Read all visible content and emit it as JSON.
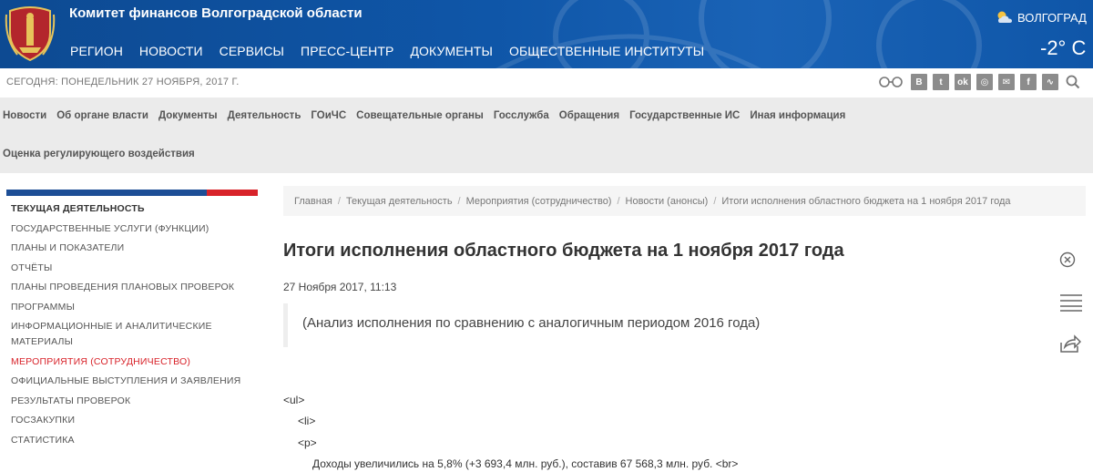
{
  "header": {
    "site_title": "Комитет финансов Волгоградской области",
    "nav": [
      "РЕГИОН",
      "НОВОСТИ",
      "СЕРВИСЫ",
      "ПРЕСС-ЦЕНТР",
      "ДОКУМЕНТЫ",
      "ОБЩЕСТВЕННЫЕ ИНСТИТУТЫ"
    ],
    "weather": {
      "city": "ВОЛГОГРАД",
      "temp": "-2° C",
      "icon": "partly-cloudy-icon"
    },
    "emblem_icon": "coat-of-arms-icon"
  },
  "date_bar": {
    "text": "СЕГОДНЯ: ПОНЕДЕЛЬНИК 27 НОЯБРЯ, 2017 Г.",
    "social": [
      {
        "name": "vk-icon",
        "glyph": "В"
      },
      {
        "name": "twitter-icon",
        "glyph": "t"
      },
      {
        "name": "odnoklassniki-icon",
        "glyph": "ok"
      },
      {
        "name": "instagram-icon",
        "glyph": "◎"
      },
      {
        "name": "mail-icon",
        "glyph": "✉"
      },
      {
        "name": "facebook-icon",
        "glyph": "f"
      },
      {
        "name": "rss-icon",
        "glyph": "∿"
      }
    ]
  },
  "secondary_nav": {
    "row1": [
      "Новости",
      "Об органе власти",
      "Документы",
      "Деятельность",
      "ГОиЧС",
      "Совещательные органы",
      "Госслужба",
      "Обращения",
      "Государственные ИС",
      "Иная информация"
    ],
    "row2": [
      "Оценка регулирующего воздействия"
    ]
  },
  "sidebar": {
    "items": [
      {
        "label": "ТЕКУЩАЯ ДЕЯТЕЛЬНОСТЬ",
        "type": "head"
      },
      {
        "label": "ГОСУДАРСТВЕННЫЕ УСЛУГИ (ФУНКЦИИ)",
        "type": "normal"
      },
      {
        "label": "ПЛАНЫ И ПОКАЗАТЕЛИ",
        "type": "normal"
      },
      {
        "label": "ОТЧЁТЫ",
        "type": "normal"
      },
      {
        "label": "ПЛАНЫ ПРОВЕДЕНИЯ ПЛАНОВЫХ ПРОВЕРОК",
        "type": "normal"
      },
      {
        "label": "ПРОГРАММЫ",
        "type": "normal"
      },
      {
        "label": "ИНФОРМАЦИОННЫЕ И АНАЛИТИЧЕСКИЕ МАТЕРИАЛЫ",
        "type": "normal"
      },
      {
        "label": "МЕРОПРИЯТИЯ (СОТРУДНИЧЕСТВО)",
        "type": "active"
      },
      {
        "label": "ОФИЦИАЛЬНЫЕ ВЫСТУПЛЕНИЯ И ЗАЯВЛЕНИЯ",
        "type": "normal"
      },
      {
        "label": "РЕЗУЛЬТАТЫ ПРОВЕРОК",
        "type": "normal"
      },
      {
        "label": "ГОСЗАКУПКИ",
        "type": "normal"
      },
      {
        "label": "СТАТИСТИКА",
        "type": "normal"
      }
    ],
    "colors": {
      "blue": "#1d4e96",
      "red": "#d8232a"
    }
  },
  "breadcrumb": [
    "Главная",
    "Текущая деятельность",
    "Мероприятия (сотрудничество)",
    "Новости (анонсы)",
    "Итоги исполнения областного бюджета на 1 ноября 2017 года"
  ],
  "article": {
    "title": "Итоги исполнения областного бюджета на 1 ноября 2017 года",
    "date": "27 Ноября 2017, 11:13",
    "lead": "(Анализ исполнения по сравнению с аналогичным периодом 2016 года)",
    "code_lines": [
      "<ul>",
      "<li>",
      "<p>",
      "Доходы увеличились на 5,8% (+3 693,4 млн. руб.), составив 67 568,3 млн. руб. <br>"
    ]
  },
  "right_tools": [
    "close-circle-icon",
    "menu-icon",
    "share-icon"
  ]
}
